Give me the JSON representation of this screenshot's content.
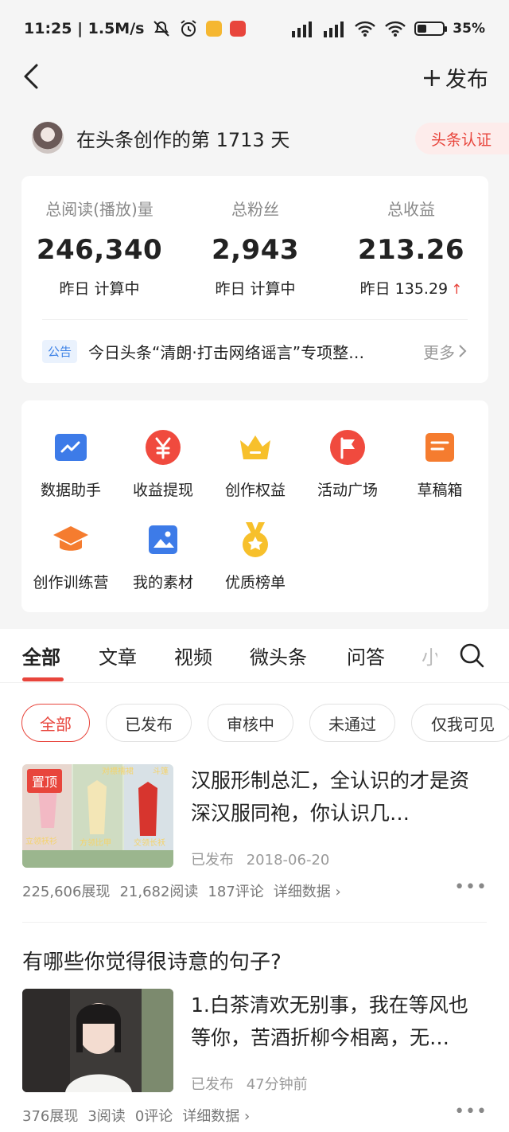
{
  "status_bar": {
    "time": "11:25 | 1.5M/s",
    "battery": "35%",
    "battery_level": 0.35,
    "icons": [
      "mute-icon",
      "alarm-icon",
      "app-icon",
      "toutiao-app-icon",
      "signal-icon",
      "signal-icon",
      "wifi-icon",
      "wifi-icon",
      "battery-icon"
    ]
  },
  "nav": {
    "publish_label": "发布"
  },
  "creator": {
    "text": "在头条创作的第 1713 天",
    "badge": "头条认证"
  },
  "stats": [
    {
      "label": "总阅读(播放)量",
      "value": "246,340",
      "sub": "昨日 计算中"
    },
    {
      "label": "总粉丝",
      "value": "2,943",
      "sub": "昨日 计算中"
    },
    {
      "label": "总收益",
      "value": "213.26",
      "sub": "昨日 135.29"
    }
  ],
  "notice": {
    "tag": "公告",
    "text": "今日头条“清朗·打击网络谣言”专项整…",
    "more": "更多"
  },
  "tools": [
    {
      "label": "数据助手",
      "icon": "chart-icon",
      "color": "#3d7be8"
    },
    {
      "label": "收益提现",
      "icon": "yuan-icon",
      "color": "#f04a3e"
    },
    {
      "label": "创作权益",
      "icon": "crown-icon",
      "color": "#f7c02b"
    },
    {
      "label": "活动广场",
      "icon": "flag-icon",
      "color": "#f04a3e"
    },
    {
      "label": "草稿箱",
      "icon": "draft-icon",
      "color": "#f57c2f"
    },
    {
      "label": "创作训练营",
      "icon": "graduation-cap-icon",
      "color": "#f57c2f"
    },
    {
      "label": "我的素材",
      "icon": "image-icon",
      "color": "#3d7be8"
    },
    {
      "label": "优质榜单",
      "icon": "medal-icon",
      "color": "#f7c02b"
    }
  ],
  "tabs": [
    "全部",
    "文章",
    "视频",
    "微头条",
    "问答",
    "小"
  ],
  "chips": [
    "全部",
    "已发布",
    "审核中",
    "未通过",
    "仅我可见"
  ],
  "articles": [
    {
      "pin": "置顶",
      "title": "汉服形制总汇，全认识的才是资深汉服同袍，你认识几…",
      "status": "已发布",
      "date": "2018-06-20",
      "impressions": "225,606展现",
      "reads": "21,682阅读",
      "comments": "187评论",
      "detail": "详细数据"
    },
    {
      "question": "有哪些你觉得很诗意的句子?",
      "title": "1.白茶清欢无别事，我在等风也等你，苦酒折柳今相离，无…",
      "status": "已发布",
      "date": "47分钟前",
      "impressions": "376展现",
      "reads": "3阅读",
      "comments": "0评论",
      "detail": "详细数据"
    }
  ],
  "thumb_labels": [
    "对襟襦裙",
    "斗篷",
    "立领袄衫",
    "方领比甲",
    "交领长袄"
  ],
  "colors": {
    "accent": "#e8453c",
    "blue": "#3d82e6"
  }
}
